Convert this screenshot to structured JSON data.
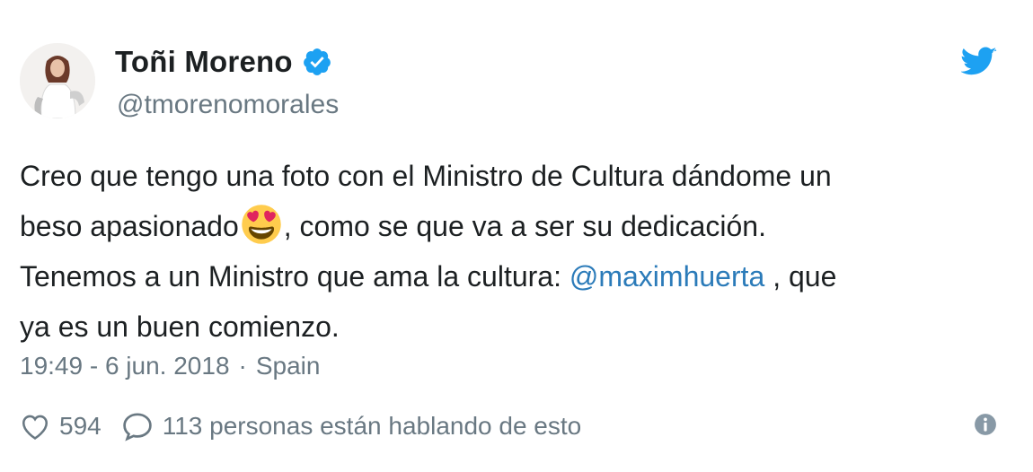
{
  "author": {
    "name": "Toñi Moreno",
    "handle": "@tmorenomorales",
    "verified": true,
    "avatar_icon": "profile-photo"
  },
  "tweet": {
    "line1": "Creo que tengo una foto con el Ministro de Cultura dándome un",
    "line2_before_emoji": "beso apasionado",
    "emoji": "heart-eyes-emoji",
    "line2_after_emoji": ", como se que va a ser su dedicación.",
    "line3_before_mention": "Tenemos a un Ministro que ama la cultura: ",
    "mention": "@maximhuerta",
    "line3_after_mention": " , que",
    "line4": "ya es un buen comienzo."
  },
  "meta": {
    "timestamp": "19:49 - 6 jun. 2018",
    "separator": "·",
    "location": "Spain"
  },
  "actions": {
    "like_count": "594",
    "reply_text": "113 personas están hablando de esto"
  },
  "icons": {
    "brand": "twitter-bird-icon",
    "verified": "verified-badge-icon",
    "like": "heart-icon",
    "reply": "speech-bubble-icon",
    "info": "info-icon"
  },
  "colors": {
    "twitter_blue": "#1da1f2",
    "mention": "#2b7bb9",
    "secondary_text": "#697882",
    "primary_text": "#1c2022"
  }
}
